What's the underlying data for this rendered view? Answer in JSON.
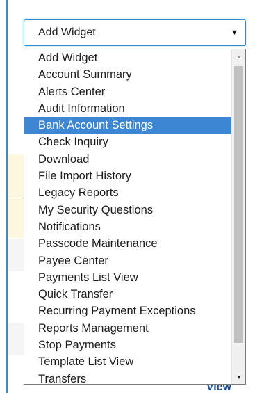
{
  "select": {
    "value": "Add Widget",
    "caret_icon": "chevron-down-icon"
  },
  "dropdown": {
    "selected_index": 4,
    "options": [
      "Add Widget",
      "Account Summary",
      "Alerts Center",
      "Audit Information",
      "Bank Account Settings",
      "Check Inquiry",
      "Download",
      "File Import History",
      "Legacy Reports",
      "My Security Questions",
      "Notifications",
      "Passcode Maintenance",
      "Payee Center",
      "Payments List View",
      "Quick Transfer",
      "Recurring Payment Exceptions",
      "Reports Management",
      "Stop Payments",
      "Template List View",
      "Transfers"
    ]
  },
  "background": {
    "link_text": "View"
  },
  "colors": {
    "accent_border": "#2d8fd0",
    "selected_bg": "#3d86d4",
    "selected_text": "#ffffff",
    "link": "#1a4c8c"
  }
}
